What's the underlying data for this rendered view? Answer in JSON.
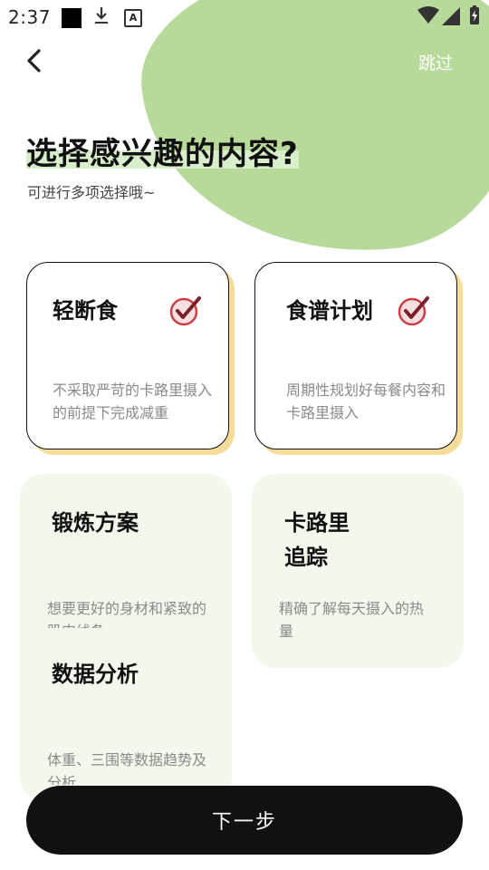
{
  "status_bar": {
    "time": "2:37",
    "icons": [
      "square-icon",
      "download-icon",
      "a-icon",
      "wifi-icon",
      "signal-icon",
      "battery-charging-icon"
    ]
  },
  "header": {
    "back_icon": "chevron-left-icon",
    "skip_label": "跳过"
  },
  "colors": {
    "accent_green": "#b7da9b",
    "highlight_green": "#d9efcb",
    "card_bg": "#f2f9ec",
    "selected_shadow": "#f5dc9a",
    "check_red": "#c8414a",
    "button_bg": "#111111"
  },
  "page": {
    "title": "选择感兴趣的内容?",
    "subtitle": "可进行多项选择哦~"
  },
  "options": [
    {
      "title": "轻断食",
      "desc": "不采取严苛的卡路里摄入的前提下完成减重",
      "selected": true
    },
    {
      "title": "食谱计划",
      "desc": "周期性规划好每餐内容和卡路里摄入",
      "selected": true
    },
    {
      "title": "锻炼方案",
      "desc": "想要更好的身材和紧致的肌肉线条",
      "selected": false
    },
    {
      "title": "卡路里追踪",
      "desc": "精确了解每天摄入的热量",
      "selected": false
    },
    {
      "title": "数据分析",
      "desc": "体重、三围等数据趋势及分析",
      "selected": false
    }
  ],
  "footer": {
    "next_label": "下一步"
  }
}
